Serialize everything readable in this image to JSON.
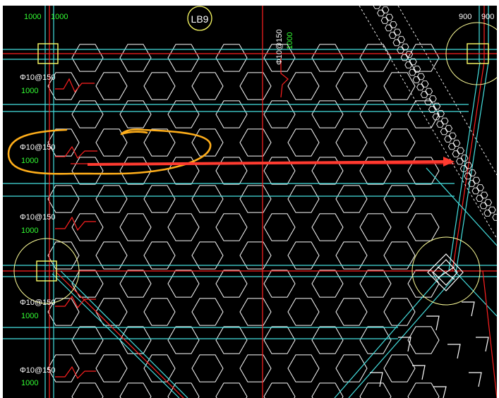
{
  "drawing": {
    "axis_bubble": "LB9",
    "labels": {
      "top_left_1": "1000",
      "top_left_2": "1000",
      "top_right_1": "900",
      "top_right_2": "900",
      "top_center_rebar": "Φ10@150",
      "top_center_len": "1000",
      "row1_rebar": "Φ10@150",
      "row1_len": "1000",
      "row2_rebar": "Φ10@150",
      "row2_len": "1000",
      "row3_rebar": "Φ10@150",
      "row3_len": "1000",
      "row4_rebar": "Φ10@150",
      "row4_len": "1000",
      "row5_rebar": "Φ10@150",
      "row5_len": "1000"
    },
    "colors": {
      "background": "#000000",
      "cyan": "#45e0e0",
      "red": "#ff2020",
      "yellow": "#ffff66",
      "green": "#33ff33",
      "white": "#ffffff",
      "orange_markup": "#ffae1a",
      "red_arrow": "#ff3b30"
    }
  }
}
